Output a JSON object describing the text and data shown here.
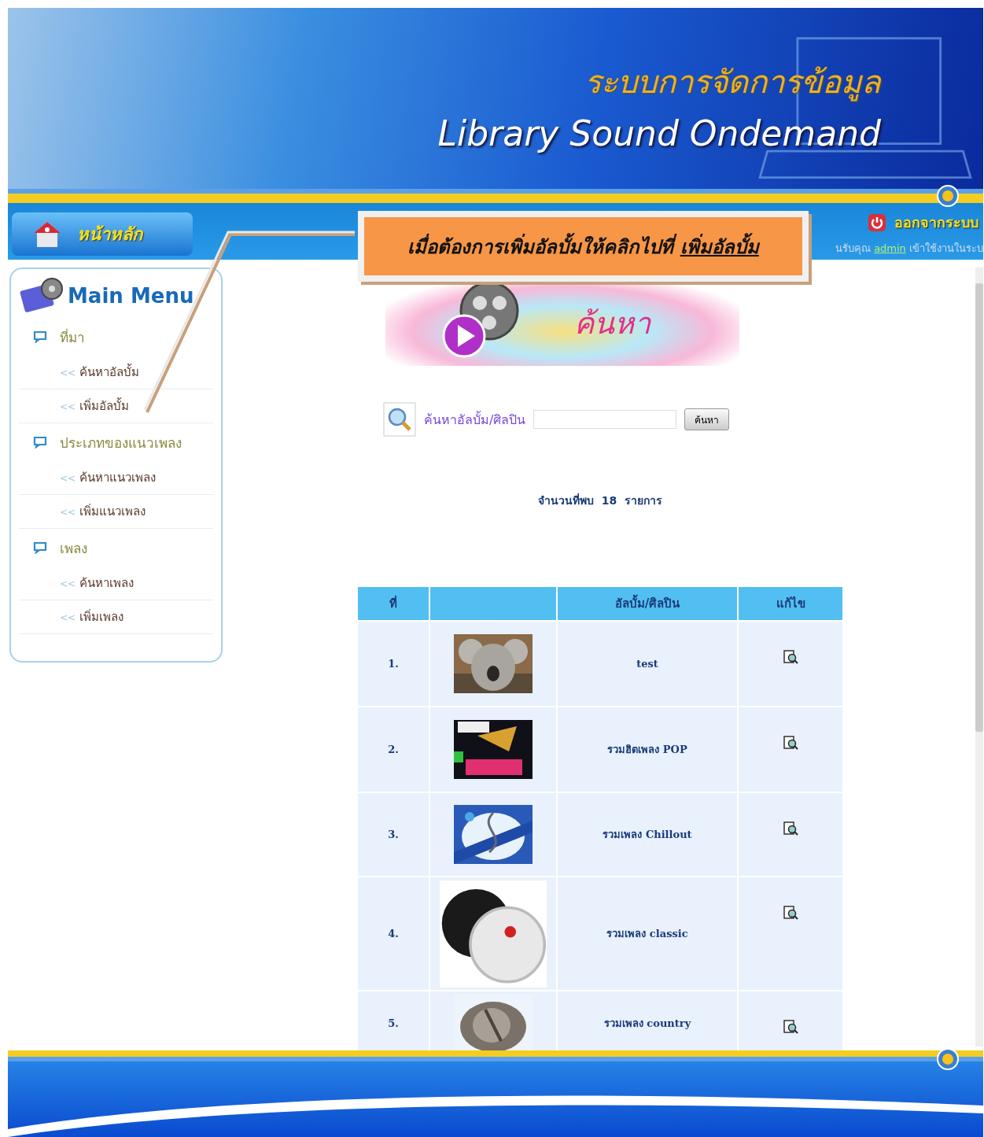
{
  "header": {
    "title_thai": "ระบบการจัดการข้อมูล",
    "title": "Library Sound Ondemand"
  },
  "nav": {
    "home_button": "หน้าหลัก",
    "logout_button": "ออกจากระบบ",
    "welcome_before": "นรับคุณ",
    "welcome_user": "admin",
    "welcome_after": "เข้าใช้งานในระบ"
  },
  "callout": {
    "text": "เมื่อต้องการเพิ่มอัลบั้มให้คลิกไปที่",
    "link": "เพิ่มอัลบั้ม"
  },
  "menu": {
    "title": "Main Menu",
    "sections": [
      {
        "label": "ที่มา",
        "items": [
          {
            "marker": "<<",
            "label": "ค้นหาอัลบั้ม"
          },
          {
            "marker": "<<",
            "label": "เพิ่มอัลบั้ม"
          }
        ]
      },
      {
        "label": "ประเภทของแนวเพลง",
        "items": [
          {
            "marker": "<<",
            "label": "ค้นหาแนวเพลง"
          },
          {
            "marker": "<<",
            "label": "เพิ่มแนวเพลง"
          }
        ]
      },
      {
        "label": "เพลง",
        "items": [
          {
            "marker": "<<",
            "label": "ค้นหาเพลง"
          },
          {
            "marker": "<<",
            "label": "เพิ่มเพลง"
          }
        ]
      }
    ]
  },
  "banner": {
    "title": "ค้นหา"
  },
  "search": {
    "label": "ค้นหาอัลบั้ม/ศิลปิน",
    "button": "ค้นหา"
  },
  "result_count": {
    "label": "จำนวนที่พบ",
    "count": "18",
    "unit": "รายการ"
  },
  "table": {
    "columns": [
      {
        "kind": "text",
        "label": "ที่"
      },
      {
        "kind": "picture"
      },
      {
        "kind": "text",
        "label": "อัลบั้ม/ศิลปิน"
      },
      {
        "kind": "text",
        "label": "แก้ไข"
      }
    ],
    "rows": [
      {
        "no": "1.",
        "album": "test"
      },
      {
        "no": "2.",
        "album": "รวมฮิตเพลง POP"
      },
      {
        "no": "3.",
        "album": "รวมเพลง Chillout"
      },
      {
        "no": "4.",
        "album": "รวมเพลง classic"
      },
      {
        "no": "5.",
        "album": "รวมเพลง country"
      }
    ]
  }
}
